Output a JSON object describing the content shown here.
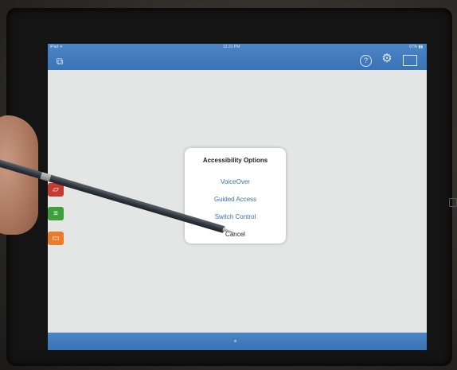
{
  "status_bar": {
    "left": "iPad ᯤ",
    "time": "12:31 PM",
    "battery": "67% ▮▮"
  },
  "toolbar": {
    "screens_icon": "⧉",
    "help_icon": "?",
    "settings_icon": "⚙",
    "image_icon": ""
  },
  "side_apps": {
    "app1": "▱",
    "app2": "≡",
    "app3": "▭"
  },
  "dialog": {
    "title": "Accessibility Options",
    "options": [
      "VoiceOver",
      "Guided Access",
      "Switch Control"
    ],
    "cancel": "Cancel"
  },
  "colors": {
    "bar_blue": "#3b73b4",
    "option_blue": "#3b6fb0"
  }
}
